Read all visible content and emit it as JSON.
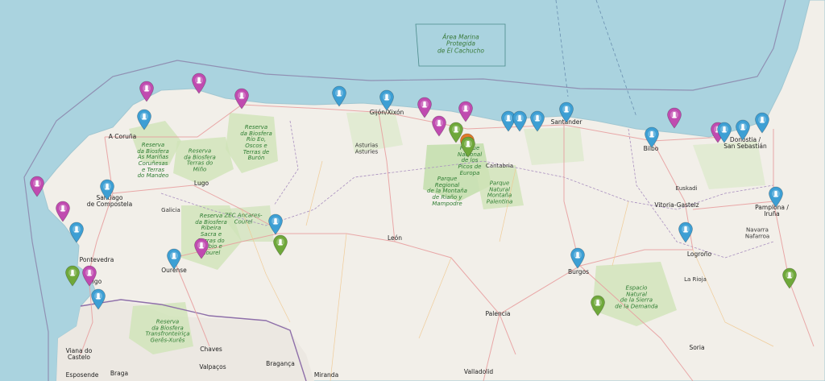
{
  "map": {
    "colors": {
      "sea": "#aad3df",
      "land": "#f2efe9",
      "green_area": "#c8e0b0",
      "marker_blue": "#3d9fd4",
      "marker_magenta": "#c04bb0",
      "marker_green": "#6fa83a",
      "marker_orange": "#e07b2a"
    },
    "sea_label": "Área Marina\nProtegida\nde El Cachucho",
    "labels": [
      {
        "id": "a-coruna",
        "text": "A Coruña",
        "type": "city"
      },
      {
        "id": "santiago",
        "text": "Santiago\nde Compostela",
        "type": "city"
      },
      {
        "id": "lugo",
        "text": "Lugo",
        "type": "city"
      },
      {
        "id": "galicia",
        "text": "Galicia",
        "type": "region"
      },
      {
        "id": "pontevedra",
        "text": "Pontevedra",
        "type": "city"
      },
      {
        "id": "vigo",
        "text": "Vigo",
        "type": "city"
      },
      {
        "id": "ourense",
        "text": "Ourense",
        "type": "city"
      },
      {
        "id": "leon",
        "text": "León",
        "type": "city"
      },
      {
        "id": "palencia",
        "text": "Palencia",
        "type": "city"
      },
      {
        "id": "valladolid",
        "text": "Valladolid",
        "type": "city"
      },
      {
        "id": "burgos",
        "text": "Burgos",
        "type": "city"
      },
      {
        "id": "gijon",
        "text": "Gijón/Xixón",
        "type": "city"
      },
      {
        "id": "asturias",
        "text": "Asturias\nAsturies",
        "type": "region"
      },
      {
        "id": "santander",
        "text": "Santander",
        "type": "city"
      },
      {
        "id": "cantabria",
        "text": "Cantabria",
        "type": "region"
      },
      {
        "id": "bilbo",
        "text": "Bilbo",
        "type": "city"
      },
      {
        "id": "donostia",
        "text": "Donostia /\nSan Sebastián",
        "type": "city"
      },
      {
        "id": "euskadi",
        "text": "Euskadi",
        "type": "region"
      },
      {
        "id": "vitoria",
        "text": "Vitoria-Gasteiz",
        "type": "city"
      },
      {
        "id": "pamplona",
        "text": "Pamplona /\nIruña",
        "type": "city"
      },
      {
        "id": "navarra",
        "text": "Navarra\nNafarroa",
        "type": "region"
      },
      {
        "id": "logrono",
        "text": "Logroño",
        "type": "city"
      },
      {
        "id": "la-rioja",
        "text": "La Rioja",
        "type": "region"
      },
      {
        "id": "soria",
        "text": "Soria",
        "type": "city"
      },
      {
        "id": "viana",
        "text": "Viana do\nCastelo",
        "type": "city"
      },
      {
        "id": "braga",
        "text": "Braga",
        "type": "city"
      },
      {
        "id": "esposende",
        "text": "Esposende",
        "type": "city"
      },
      {
        "id": "chaves",
        "text": "Chaves",
        "type": "city"
      },
      {
        "id": "braganca",
        "text": "Bragança",
        "type": "city"
      },
      {
        "id": "valpacos",
        "text": "Valpaços",
        "type": "city"
      },
      {
        "id": "miranda",
        "text": "Miranda",
        "type": "city"
      },
      {
        "id": "reserva-mariñas",
        "text": "Reserva\nda Biosfera\nAs Mariñas\nCoruñesas\ne Terras\ndo Mandeo",
        "type": "park"
      },
      {
        "id": "reserva-mino",
        "text": "Reserva\nda Biosfera\nTerras do\nMiño",
        "type": "park"
      },
      {
        "id": "reserva-rio-eo",
        "text": "Reserva\nda Biosfera\nRío Eo,\nOscos e\nTerras de\nBurón",
        "type": "park"
      },
      {
        "id": "ancares",
        "text": "ZEC Ancares-\nCourel",
        "type": "park"
      },
      {
        "id": "reserva-ribeira",
        "text": "Reserva\nda Biosfera\nRibeira\nSacra e\nSerras do\nOribio e\nCourel",
        "type": "park"
      },
      {
        "id": "picos",
        "text": "Parque\nNacional\nde los\nPicos de\nEuropa",
        "type": "park"
      },
      {
        "id": "fuentes-carrionas",
        "text": "Parque\nRegional\nde la Montaña\nde Riaño y\nMampodre",
        "type": "park"
      },
      {
        "id": "montana-palentina",
        "text": "Parque\nNatural\nMontaña\nPalentina",
        "type": "park"
      },
      {
        "id": "sierra-demanda",
        "text": "Espacio\nNatural\nde la Sierra\nde la Demanda",
        "type": "park"
      },
      {
        "id": "geres",
        "text": "Reserva\nda Biosfera\nTransfronteiriça\nGerês-Xurês",
        "type": "park"
      }
    ],
    "markers": [
      {
        "color": "magenta"
      },
      {
        "color": "magenta"
      },
      {
        "color": "magenta"
      },
      {
        "color": "blue"
      },
      {
        "color": "blue"
      },
      {
        "color": "magenta"
      },
      {
        "color": "magenta"
      },
      {
        "color": "magenta"
      },
      {
        "color": "green"
      },
      {
        "color": "orange"
      },
      {
        "color": "green"
      },
      {
        "color": "blue"
      },
      {
        "color": "blue"
      },
      {
        "color": "blue"
      },
      {
        "color": "blue"
      },
      {
        "color": "blue"
      },
      {
        "color": "magenta"
      },
      {
        "color": "magenta"
      },
      {
        "color": "blue"
      },
      {
        "color": "blue"
      },
      {
        "color": "blue"
      },
      {
        "color": "blue"
      },
      {
        "color": "magenta"
      },
      {
        "color": "blue"
      },
      {
        "color": "magenta"
      },
      {
        "color": "blue"
      },
      {
        "color": "magenta"
      },
      {
        "color": "blue"
      },
      {
        "color": "blue"
      },
      {
        "color": "blue"
      },
      {
        "color": "green"
      },
      {
        "color": "magenta"
      },
      {
        "color": "blue"
      },
      {
        "color": "green"
      },
      {
        "color": "blue"
      },
      {
        "color": "blue"
      },
      {
        "color": "green"
      },
      {
        "color": "green"
      }
    ]
  }
}
